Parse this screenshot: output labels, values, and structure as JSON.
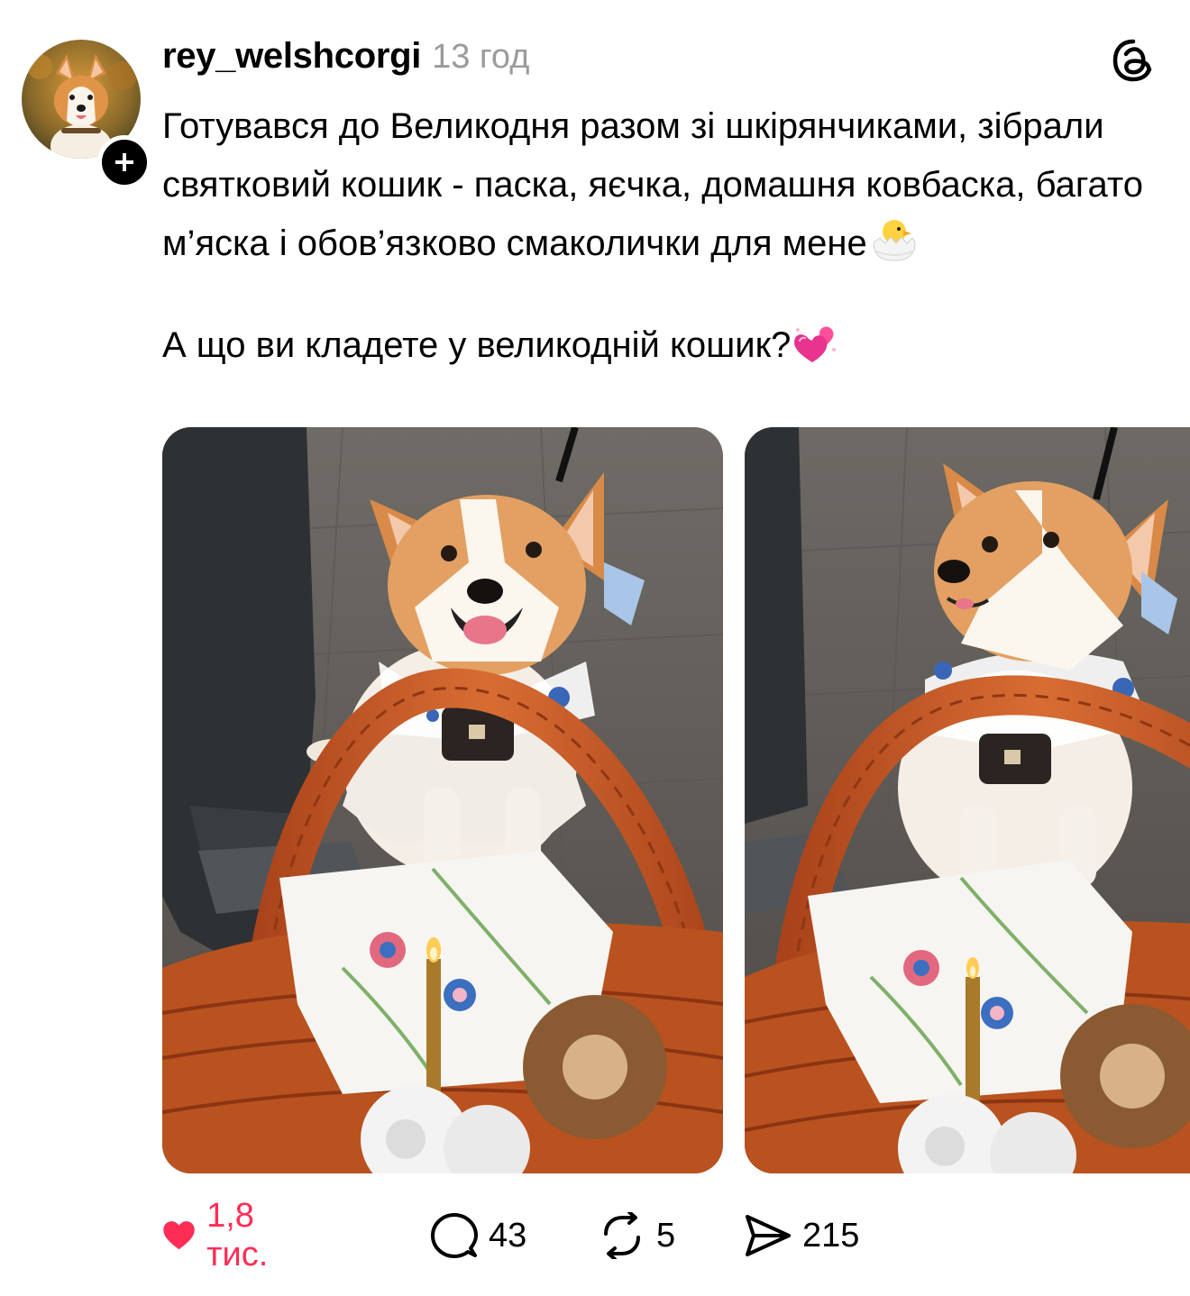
{
  "post": {
    "username": "rey_welshcorgi",
    "time": "13 год",
    "caption_p1": "Готувався до Великодня разом зі шкірянчиками, зібрали святковий кошик - паска, яєчка, домашня ковбаска, багато м’яска і обов’язково смаколички для мене",
    "caption_p1_emoji": "hatching-chick-icon",
    "caption_p2": "А що ви кладете у великодній кошик?",
    "caption_p2_emoji": "two-hearts-icon",
    "images": [
      {
        "description_icon": "corgi-photo-1"
      },
      {
        "description_icon": "corgi-photo-2"
      }
    ]
  },
  "actions": {
    "likes": "1,8 тис.",
    "comments": "43",
    "reposts": "5",
    "shares": "215"
  },
  "colors": {
    "like": "#ff2d55",
    "muted": "#9b9b9b",
    "basket": "#c4561f"
  }
}
